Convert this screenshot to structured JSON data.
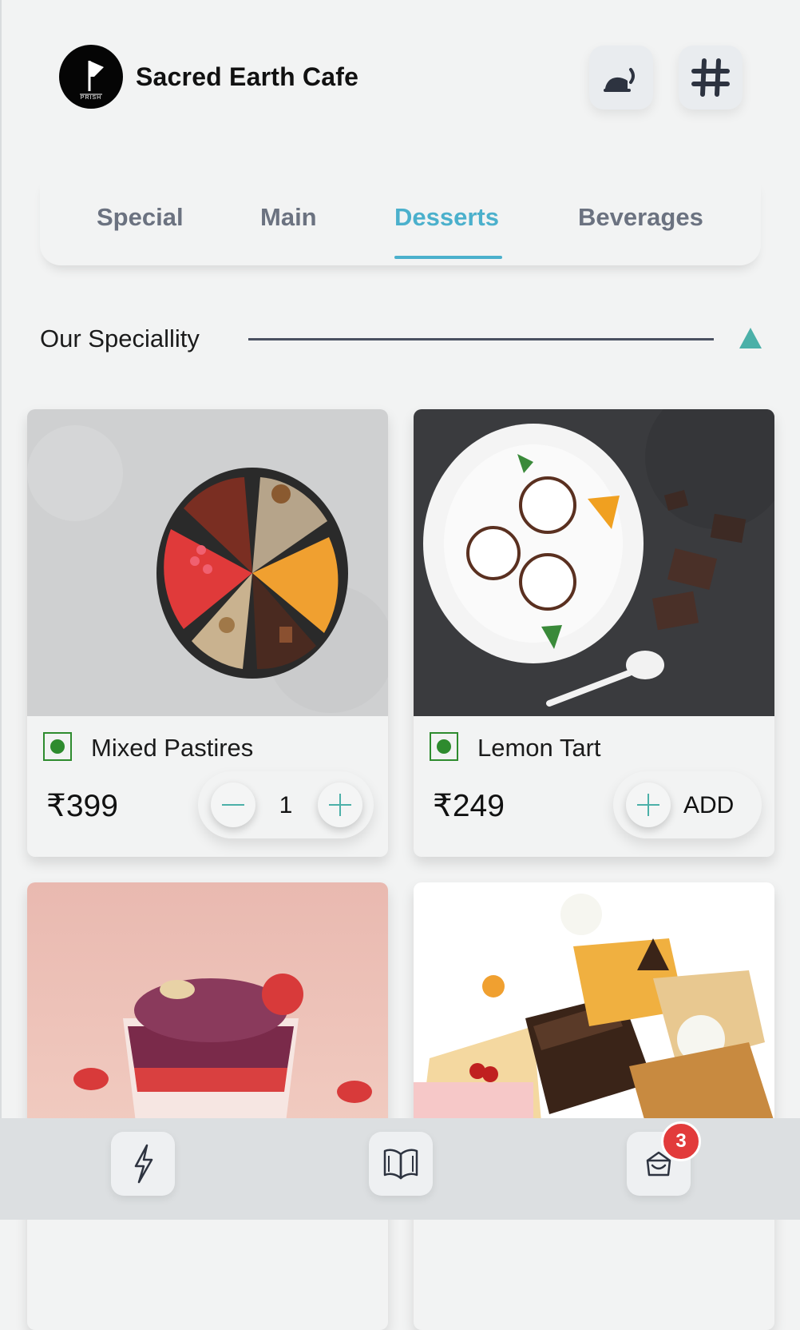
{
  "header": {
    "brand_name": "Sacred Earth Cafe",
    "logo_text": "PRISH",
    "call_waiter_icon": "waiter-bell-icon",
    "table_number_icon": "hash-icon"
  },
  "tabs": [
    {
      "label": "Special",
      "active": false
    },
    {
      "label": "Main",
      "active": false
    },
    {
      "label": "Desserts",
      "active": true
    },
    {
      "label": "Beverages",
      "active": false
    }
  ],
  "section": {
    "title": "Our Speciallity",
    "toggle_icon": "triangle-up-icon"
  },
  "items": [
    {
      "name": "Mixed Pastires",
      "price": "₹399",
      "veg": true,
      "quantity": "1",
      "photo": "mixed-pastries-photo"
    },
    {
      "name": "Lemon Tart",
      "price": "₹249",
      "veg": true,
      "add_label": "ADD",
      "photo": "lemon-tart-photo"
    },
    {
      "photo": "berry-parfait-photo"
    },
    {
      "photo": "pastry-assortment-photo"
    }
  ],
  "bottom_nav": {
    "items": [
      {
        "icon": "lightning-icon"
      },
      {
        "icon": "menu-book-icon"
      },
      {
        "icon": "cart-bag-icon"
      }
    ],
    "cart_count": "3"
  },
  "colors": {
    "accent": "#4bb0cc",
    "teal": "#4bb0a8",
    "veg_green": "#2e8b2e",
    "badge_red": "#e23b3b"
  }
}
